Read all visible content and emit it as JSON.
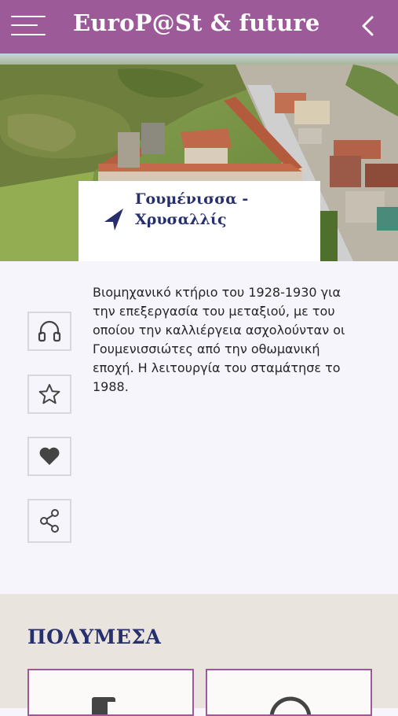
{
  "header": {
    "title": "EuroP@St & future",
    "menu_icon": "hamburger-menu-icon",
    "back_icon": "chevron-left-icon"
  },
  "hero": {
    "image": "aerial-photo-silk-factory"
  },
  "place": {
    "name": "Γουμένισσα - Χρυσαλλίς",
    "icon": "navigation-arrow-icon"
  },
  "actions": [
    {
      "name": "audio",
      "icon": "headphones-icon"
    },
    {
      "name": "favorite",
      "icon": "star-icon"
    },
    {
      "name": "like",
      "icon": "heart-icon"
    },
    {
      "name": "share",
      "icon": "share-icon"
    }
  ],
  "description": "Βιομηχανικό κτήριο του 1928-1930 για την επεξεργασία του μεταξιού, με του οποίου την καλλιέργεια ασχολούνταν οι Γουμενισσιώτες από την οθωμανική εποχή. Η λειτουργία του σταμάτησε το 1988.",
  "media": {
    "title": "ΠΟΛΥΜΕΣΑ",
    "items": [
      {
        "icon": "gallery-icon"
      },
      {
        "icon": "video-icon"
      }
    ]
  },
  "colors": {
    "header_bg": "#9c5a99",
    "accent_text": "#27306d",
    "media_bg": "#e9e4de"
  }
}
